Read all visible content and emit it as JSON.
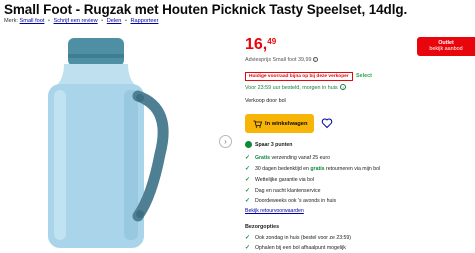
{
  "product": {
    "title": "Small Foot - Rugzak met Houten Picknick Tasty Speelset, 14dlg.",
    "brand_label": "Merk:",
    "brand": "Small foot",
    "review_link": "Schrijf een review",
    "share_link": "Delen",
    "report_link": "Rapporteer"
  },
  "price": {
    "whole": "16,",
    "cents": "49",
    "rrp": "Adviesprijs Small foot 39,99"
  },
  "outlet": {
    "line1": "Outlet",
    "line2": "bekijk aanbod"
  },
  "deal": {
    "label": "Huidige voorraad bijna op bij deze verkoper",
    "select": "Select"
  },
  "delivery": {
    "text": "Voor 23:59 uur besteld, morgen in huis"
  },
  "seller": "Verkoop door bol",
  "cart": {
    "label": "In winkelwagen"
  },
  "spaar": "Spaar 3 punten",
  "usps": [
    {
      "prefix": "",
      "bold": "Gratis",
      "suffix": " verzending vanaf 25 euro"
    },
    {
      "prefix": "30 dagen bedenktijd en ",
      "bold": "gratis",
      "suffix": " retourneren via mijn bol"
    },
    {
      "prefix": "Wettelijke garantie via bol",
      "bold": "",
      "suffix": ""
    },
    {
      "prefix": "Dag en nacht klantenservice",
      "bold": "",
      "suffix": ""
    },
    {
      "prefix": "Doordeweeks ook 's avonds in huis",
      "bold": "",
      "suffix": ""
    }
  ],
  "return_link": "Bekijk retourvoorwaarden",
  "bezorgopties": {
    "title": "Bezorgopties",
    "items": [
      "Ook zondag in huis (bestel voor ze 23:59)",
      "Ophalen bij een bol afhaalpunt mogelijk"
    ]
  },
  "colors": {
    "price_red": "#e8050b",
    "cart_yellow": "#f8b407",
    "link_blue": "#0000a4",
    "green": "#0a8a3a",
    "bottle": "#a9d4e9",
    "cap": "#4f8fa3"
  },
  "icons": {
    "next": "chevron-right-icon",
    "cart": "cart-icon",
    "heart": "heart-icon",
    "check": "check-icon",
    "info": "info-icon"
  }
}
